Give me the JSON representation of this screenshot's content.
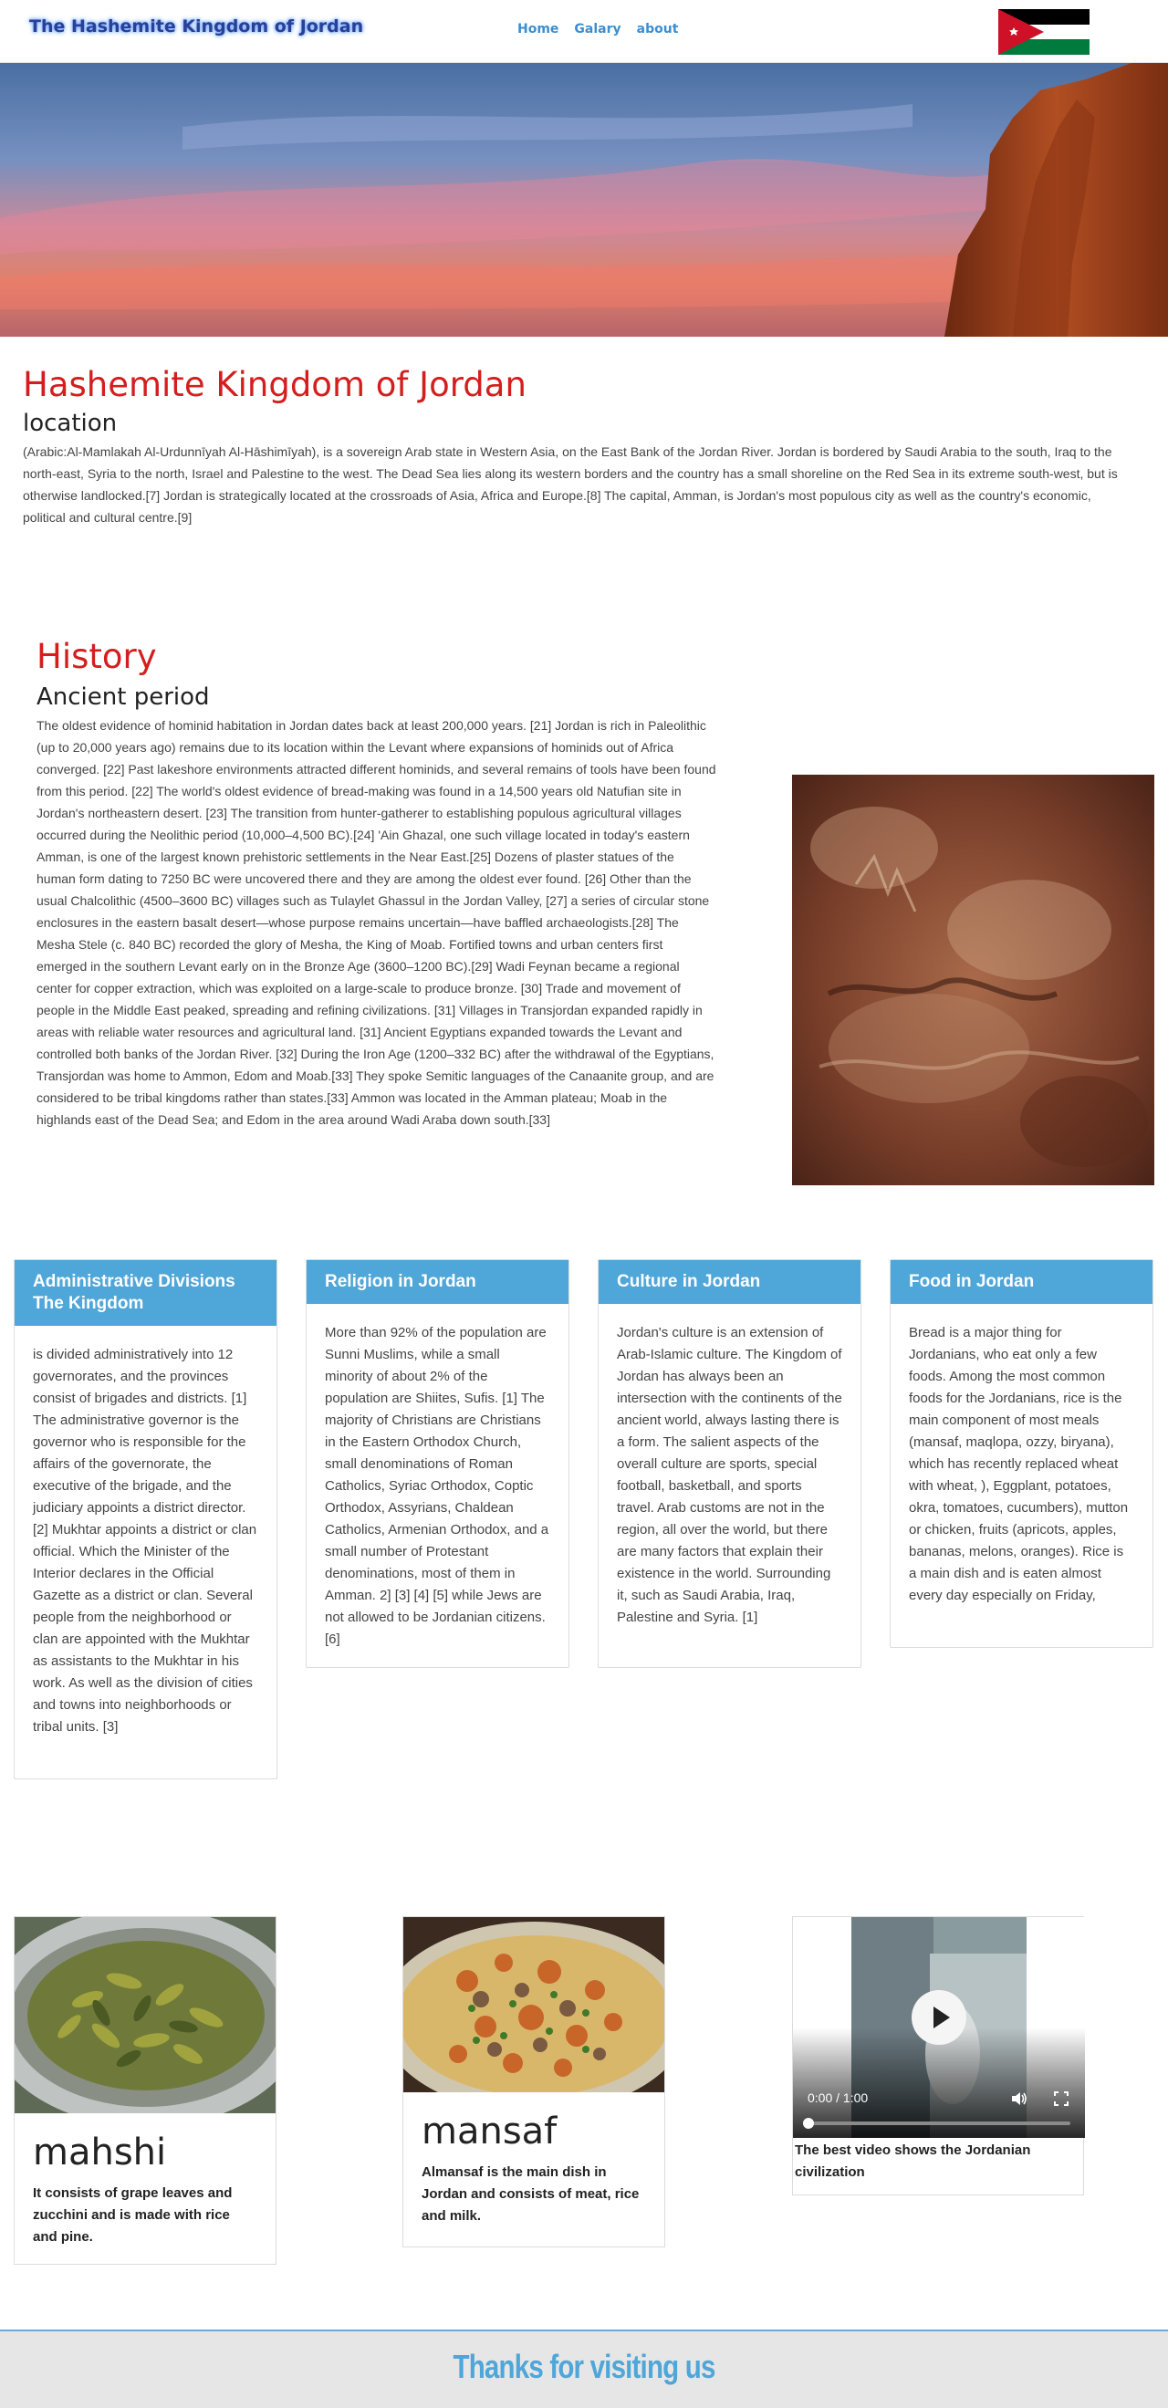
{
  "navbar": {
    "brand": "The Hashemite Kingdom of Jordan",
    "links": [
      "Home",
      "Galary",
      "about"
    ]
  },
  "intro": {
    "title": "Hashemite Kingdom of Jordan",
    "subtitle": "location",
    "text": "(Arabic:Al-Mamlakah Al-Urdunnīyah Al-Hāshimīyah), is a sovereign Arab state in Western Asia, on the East Bank of the Jordan River. Jordan is bordered by Saudi Arabia to the south, Iraq to the north-east, Syria to the north, Israel and Palestine to the west. The Dead Sea lies along its western borders and the country has a small shoreline on the Red Sea in its extreme south-west, but is otherwise landlocked.[7] Jordan is strategically located at the crossroads of Asia, Africa and Europe.[8] The capital, Amman, is Jordan's most populous city as well as the country's economic, political and cultural centre.[9]"
  },
  "history": {
    "title": "History",
    "subtitle": "Ancient period",
    "text": "The oldest evidence of hominid habitation in Jordan dates back at least 200,000 years. [21] Jordan is rich in Paleolithic (up to 20,000 years ago) remains due to its location within the Levant where expansions of hominids out of Africa converged. [22] Past lakeshore environments attracted different hominids, and several remains of tools have been found from this period. [22] The world's oldest evidence of bread-making was found in a 14,500 years old Natufian site in Jordan's northeastern desert. [23] The transition from hunter-gatherer to establishing populous agricultural villages occurred during the Neolithic period (10,000–4,500 BC).[24] 'Ain Ghazal, one such village located in today's eastern Amman, is one of the largest known prehistoric settlements in the Near East.[25] Dozens of plaster statues of the human form dating to 7250 BC were uncovered there and they are among the oldest ever found. [26] Other than the usual Chalcolithic (4500–3600 BC) villages such as Tulaylet Ghassul in the Jordan Valley, [27] a series of circular stone enclosures in the eastern basalt desert—whose purpose remains uncertain—have baffled archaeologists.[28] The Mesha Stele (c. 840 BC) recorded the glory of Mesha, the King of Moab. Fortified towns and urban centers first emerged in the southern Levant early on in the Bronze Age (3600–1200 BC).[29] Wadi Feynan became a regional center for copper extraction, which was exploited on a large-scale to produce bronze. [30] Trade and movement of people in the Middle East peaked, spreading and refining civilizations. [31] Villages in Transjordan expanded rapidly in areas with reliable water resources and agricultural land. [31] Ancient Egyptians expanded towards the Levant and controlled both banks of the Jordan River. [32] During the Iron Age (1200–332 BC) after the withdrawal of the Egyptians, Transjordan was home to Ammon, Edom and Moab.[33] They spoke Semitic languages of the Canaanite group, and are considered to be tribal kingdoms rather than states.[33] Ammon was located in the Amman plateau; Moab in the highlands east of the Dead Sea; and Edom in the area around Wadi Araba down south.[33]"
  },
  "panels": [
    {
      "title": "Administrative Divisions The Kingdom",
      "text": "is divided administratively into 12 governorates, and the provinces consist of brigades and districts. [1] The administrative governor is the governor who is responsible for the affairs of the governorate, the executive of the brigade, and the judiciary appoints a district director. [2] Mukhtar appoints a district or clan official. Which the Minister of the Interior declares in the Official Gazette as a district or clan. Several people from the neighborhood or clan are appointed with the Mukhtar as assistants to the Mukhtar in his work. As well as the division of cities and towns into neighborhoods or tribal units. [3]"
    },
    {
      "title": "Religion in Jordan",
      "text": "More than 92% of the population are Sunni Muslims, while a small minority of about 2% of the population are Shiites, Sufis. [1] The majority of Christians are Christians in the Eastern Orthodox Church, small denominations of Roman Catholics, Syriac Orthodox, Coptic Orthodox, Assyrians, Chaldean Catholics, Armenian Orthodox, and a small number of Protestant denominations, most of them in Amman. 2] [3] [4] [5] while Jews are not allowed to be Jordanian citizens. [6]"
    },
    {
      "title": "Culture in Jordan",
      "text": "Jordan's culture is an extension of Arab-Islamic culture. The Kingdom of Jordan has always been an intersection with the continents of the ancient world, always lasting there is a form. The salient aspects of the overall culture are sports, special football, basketball, and sports travel. Arab customs are not in the region, all over the world, but there are many factors that explain their existence in the world. Surrounding it, such as Saudi Arabia, Iraq, Palestine and Syria. [1]"
    },
    {
      "title": "Food in Jordan",
      "text": "Bread is a major thing for Jordanians, who eat only a few foods. Among the most common foods for the Jordanians, rice is the main component of most meals (mansaf, maqlopa, ozzy, biryana), which has recently replaced wheat with wheat, ), Eggplant, potatoes, okra, tomatoes, cucumbers), mutton or chicken, fruits (apricots, apples, bananas, melons, oranges). Rice is a main dish and is eaten almost every day especially on Friday,"
    }
  ],
  "foods": [
    {
      "name": "mahshi",
      "desc": "It consists of grape leaves and zucchini and is made with rice and pine."
    },
    {
      "name": "mansaf",
      "desc": "Almansaf is the main dish in Jordan and consists of meat, rice and milk."
    }
  ],
  "video": {
    "time": "0:00 / 1:00",
    "progress": 0,
    "caption": "The best video shows the Jordanian civilization"
  },
  "footer": {
    "text": "Thanks for visiting us"
  },
  "colors": {
    "accent": "#4fa6d8",
    "heading_red": "#d41e1e",
    "brand": "#2a3f96"
  }
}
